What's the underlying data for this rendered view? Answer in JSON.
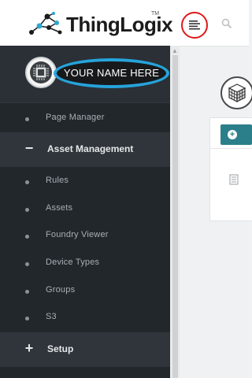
{
  "header": {
    "logo_text": "ThingLogix",
    "logo_tm": "TM",
    "menu_icon": "hamburger-icon",
    "search_icon": "search-icon"
  },
  "profile": {
    "name_placeholder": "YOUR NAME HERE",
    "avatar_icon": "chip-avatar-icon",
    "highlight_color": "#26a3db"
  },
  "sidebar": {
    "items": [
      {
        "label": "Page Manager",
        "type": "item"
      },
      {
        "label": "Asset Management",
        "type": "section",
        "symbol": "−"
      },
      {
        "label": "Rules",
        "type": "item"
      },
      {
        "label": "Assets",
        "type": "item"
      },
      {
        "label": "Foundry Viewer",
        "type": "item"
      },
      {
        "label": "Device Types",
        "type": "item"
      },
      {
        "label": "Groups",
        "type": "item"
      },
      {
        "label": "S3",
        "type": "item"
      },
      {
        "label": "Setup",
        "type": "section",
        "symbol": "+"
      }
    ]
  },
  "colors": {
    "sidebar_bg": "#22272b",
    "accent_teal": "#2b7f8b",
    "menu_highlight": "#e01818"
  }
}
